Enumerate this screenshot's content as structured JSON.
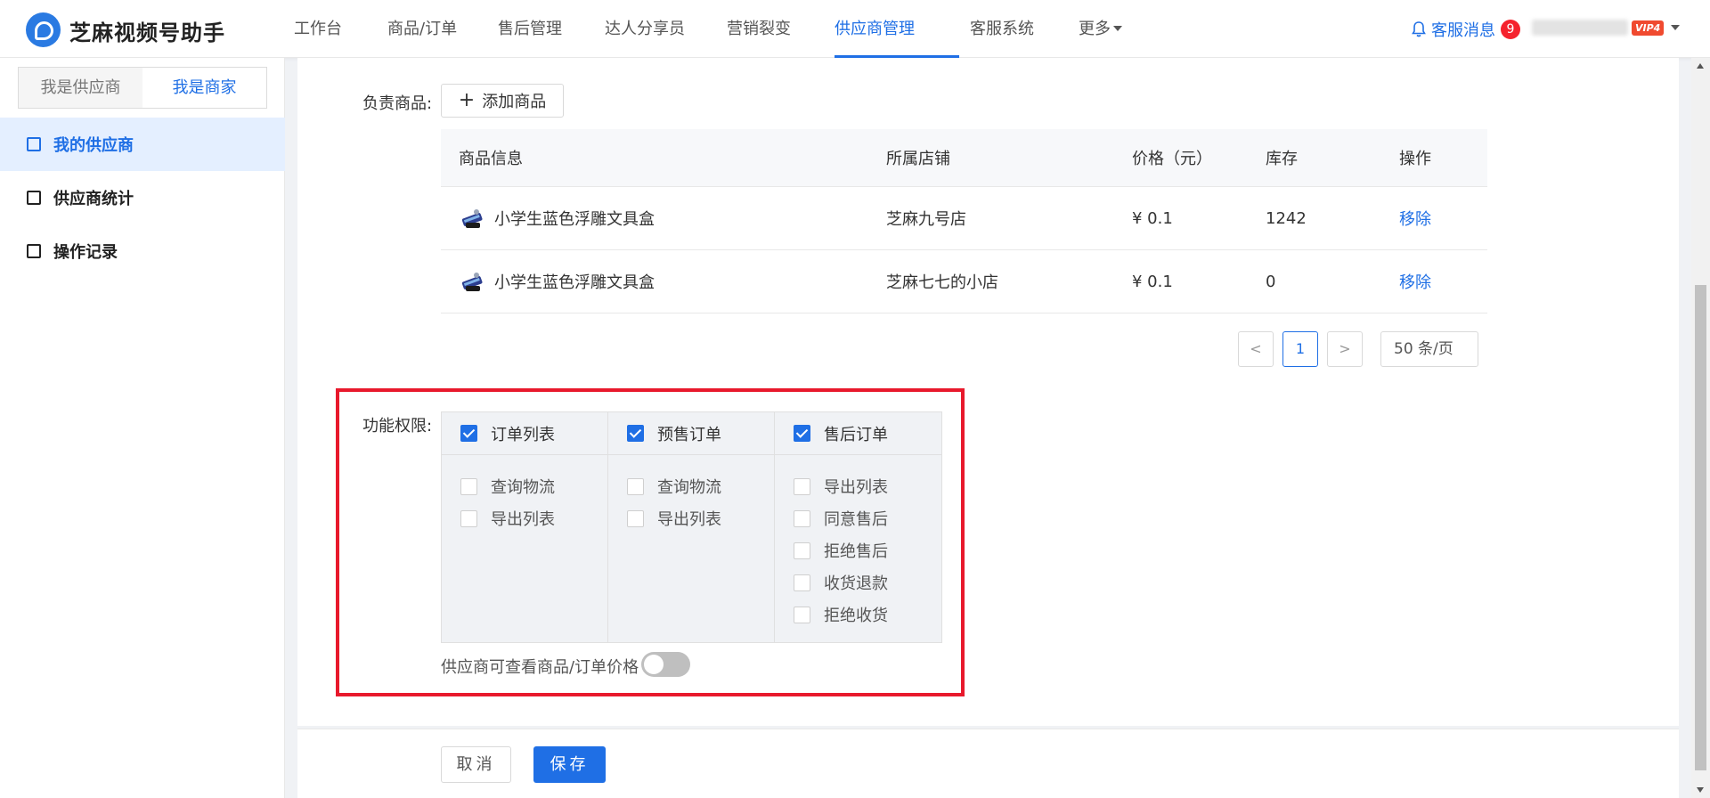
{
  "app": {
    "title": "芝麻视频号助手"
  },
  "nav": [
    {
      "label": "工作台"
    },
    {
      "label": "商品/订单"
    },
    {
      "label": "售后管理"
    },
    {
      "label": "达人分享员"
    },
    {
      "label": "营销裂变"
    },
    {
      "label": "供应商管理",
      "active": true
    },
    {
      "label": "客服系统"
    },
    {
      "label": "更多"
    }
  ],
  "header": {
    "messages_label": "客服消息",
    "messages_count": "9",
    "vip_label": "VIP4"
  },
  "sidebar": {
    "segments": [
      {
        "label": "我是供应商"
      },
      {
        "label": "我是商家",
        "active": true
      }
    ],
    "items": [
      {
        "label": "我的供应商",
        "active": true,
        "icon": "supplier-icon"
      },
      {
        "label": "供应商统计",
        "icon": "chart-icon"
      },
      {
        "label": "操作记录",
        "icon": "record-icon"
      }
    ]
  },
  "products": {
    "label": "负责商品:",
    "add_button": "添加商品",
    "columns": [
      "商品信息",
      "所属店铺",
      "价格（元）",
      "库存",
      "操作"
    ],
    "rows": [
      {
        "name": "小学生蓝色浮雕文具盒",
        "shop": "芝麻九号店",
        "price": "¥ 0.1",
        "stock": "1242",
        "action": "移除"
      },
      {
        "name": "小学生蓝色浮雕文具盒",
        "shop": "芝麻七七的小店",
        "price": "¥ 0.1",
        "stock": "0",
        "action": "移除"
      }
    ]
  },
  "pagination": {
    "prev": "<",
    "current": "1",
    "next": ">",
    "page_size": "50 条/页"
  },
  "permissions": {
    "label": "功能权限:",
    "groups": [
      {
        "title": "订单列表",
        "checked": true,
        "items": [
          "查询物流",
          "导出列表"
        ]
      },
      {
        "title": "预售订单",
        "checked": true,
        "items": [
          "查询物流",
          "导出列表"
        ]
      },
      {
        "title": "售后订单",
        "checked": true,
        "items": [
          "导出列表",
          "同意售后",
          "拒绝售后",
          "收货退款",
          "拒绝收货"
        ]
      }
    ],
    "toggle_label": "供应商可查看商品/订单价格",
    "toggle_on": false
  },
  "footer": {
    "cancel": "取消",
    "save": "保存"
  },
  "colors": {
    "primary": "#1f6fe5",
    "highlight": "#e8192c",
    "badge": "#f5222d"
  }
}
